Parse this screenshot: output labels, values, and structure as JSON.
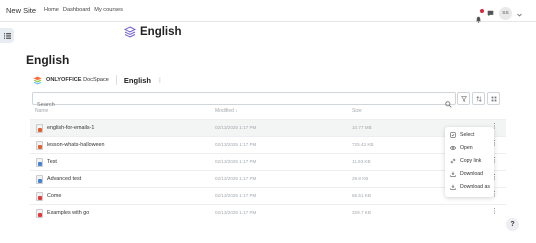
{
  "topbar": {
    "site_name": "New Site",
    "nav": [
      "Home",
      "Dashboard",
      "My courses"
    ],
    "avatar_initials": "SS"
  },
  "course": {
    "title": "English"
  },
  "page_title": "English",
  "docspace": {
    "logo_bold": "ONLYOFFICE",
    "logo_light": "DocSpace",
    "folder_name": "English"
  },
  "search": {
    "placeholder": "Search"
  },
  "columns": {
    "name": "Name",
    "modified": "Modified ↓",
    "size": "Size"
  },
  "files": [
    {
      "name": "english-for-emails-1",
      "modified": "02/13/2025 1:17 PM",
      "size": "10.77 MB",
      "type": "presentation"
    },
    {
      "name": "lesson-whats-halloween",
      "modified": "02/13/2025 1:17 PM",
      "size": "725.42 KB",
      "type": "presentation"
    },
    {
      "name": "Test",
      "modified": "02/13/2025 1:17 PM",
      "size": "11.93 KB",
      "type": "document"
    },
    {
      "name": "Advanced test",
      "modified": "02/13/2025 1:17 PM",
      "size": "29.8 KB",
      "type": "document"
    },
    {
      "name": "Come",
      "modified": "02/13/2025 1:17 PM",
      "size": "65.51 KB",
      "type": "pdf"
    },
    {
      "name": "Examples with go",
      "modified": "02/13/2025 1:17 PM",
      "size": "329.7 KB",
      "type": "pdf"
    }
  ],
  "context_menu": [
    "Select",
    "Open",
    "Copy link",
    "Download",
    "Download as"
  ],
  "help_label": "?",
  "colors": {
    "accent": "#4781d1",
    "presentation": "#e0602e",
    "document": "#4781d1",
    "pdf": "#e03a3a",
    "brand_purple": "#6f5cd6"
  }
}
